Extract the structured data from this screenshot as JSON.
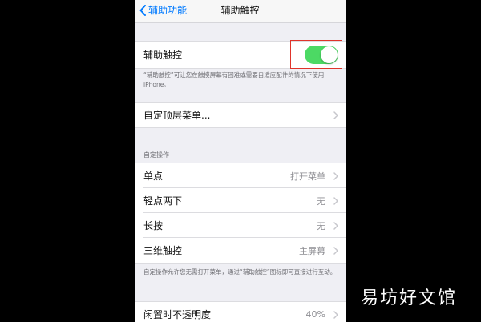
{
  "navbar": {
    "back_label": "辅助功能",
    "title": "辅助触控"
  },
  "assistive_touch": {
    "label": "辅助触控",
    "enabled": true,
    "description": "“辅助触控”可让您在触摸屏幕有困难或需要自适应配件的情况下使用 iPhone。"
  },
  "top_menu": {
    "label": "自定顶层菜单..."
  },
  "custom_actions": {
    "header": "自定操作",
    "rows": [
      {
        "label": "单点",
        "value": "打开菜单"
      },
      {
        "label": "轻点两下",
        "value": "无"
      },
      {
        "label": "长按",
        "value": "无"
      },
      {
        "label": "三维触控",
        "value": "主屏幕"
      }
    ],
    "footnote": "自定操作允许您无需打开菜单，通过“辅助触控”图标即可直接进行互动。"
  },
  "idle_opacity": {
    "label": "闲置时不透明度",
    "value": "40%"
  },
  "watermark": "易坊好文馆",
  "colors": {
    "toggle_on": "#4cd964",
    "ios_blue": "#007aff",
    "highlight": "#e0342b"
  }
}
